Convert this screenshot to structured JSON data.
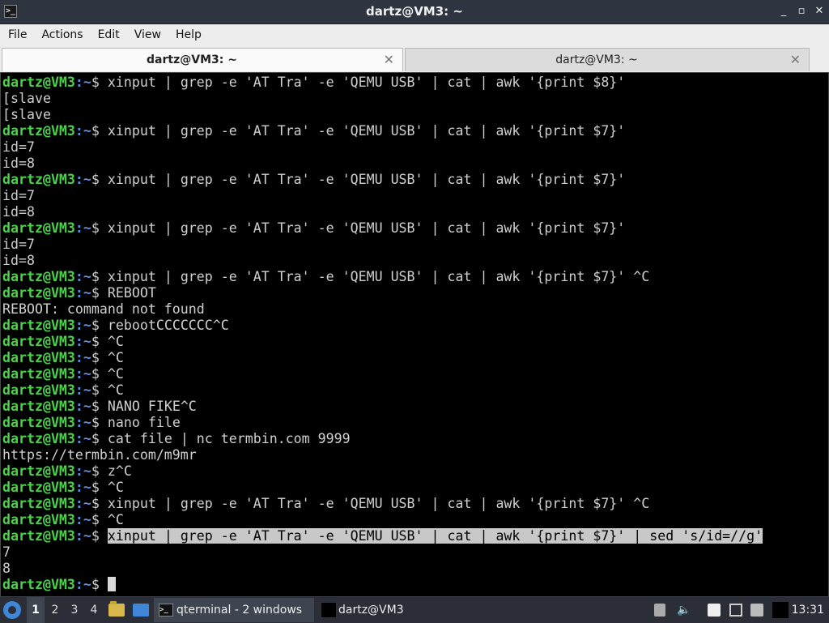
{
  "window": {
    "title": "dartz@VM3: ~",
    "controls": [
      "_",
      "▫",
      "✕"
    ]
  },
  "menu": [
    "File",
    "Actions",
    "Edit",
    "View",
    "Help"
  ],
  "tabs": [
    {
      "label": "dartz@VM3: ~",
      "active": true
    },
    {
      "label": "dartz@VM3: ~",
      "active": false
    }
  ],
  "terminal": {
    "lines": [
      {
        "user": "dartz@VM3",
        "path": "~",
        "cmd": "xinput | grep -e 'AT Tra' -e 'QEMU USB' | cat | awk '{print $8}'"
      },
      {
        "out": "[slave"
      },
      {
        "out": "[slave"
      },
      {
        "user": "dartz@VM3",
        "path": "~",
        "cmd": "xinput | grep -e 'AT Tra' -e 'QEMU USB' | cat | awk '{print $7}'"
      },
      {
        "out": "id=7"
      },
      {
        "out": "id=8"
      },
      {
        "user": "dartz@VM3",
        "path": "~",
        "cmd": "xinput | grep -e 'AT Tra' -e 'QEMU USB' | cat | awk '{print $7}'"
      },
      {
        "out": "id=7"
      },
      {
        "out": "id=8"
      },
      {
        "user": "dartz@VM3",
        "path": "~",
        "cmd": "xinput | grep -e 'AT Tra' -e 'QEMU USB' | cat | awk '{print $7}'"
      },
      {
        "out": "id=7"
      },
      {
        "out": "id=8"
      },
      {
        "user": "dartz@VM3",
        "path": "~",
        "cmd": "xinput | grep -e 'AT Tra' -e 'QEMU USB' | cat | awk '{print $7}' ^C"
      },
      {
        "user": "dartz@VM3",
        "path": "~",
        "cmd": "REBOOT"
      },
      {
        "out": "REBOOT: command not found"
      },
      {
        "user": "dartz@VM3",
        "path": "~",
        "cmd": "rebootCCCCCCC^C"
      },
      {
        "user": "dartz@VM3",
        "path": "~",
        "cmd": "^C"
      },
      {
        "user": "dartz@VM3",
        "path": "~",
        "cmd": "^C"
      },
      {
        "user": "dartz@VM3",
        "path": "~",
        "cmd": "^C"
      },
      {
        "user": "dartz@VM3",
        "path": "~",
        "cmd": "^C"
      },
      {
        "user": "dartz@VM3",
        "path": "~",
        "cmd": "NANO FIKE^C"
      },
      {
        "user": "dartz@VM3",
        "path": "~",
        "cmd": "nano file"
      },
      {
        "user": "dartz@VM3",
        "path": "~",
        "cmd": "cat file | nc termbin.com 9999"
      },
      {
        "out": "https://termbin.com/m9mr"
      },
      {
        "user": "dartz@VM3",
        "path": "~",
        "cmd": "z^C"
      },
      {
        "user": "dartz@VM3",
        "path": "~",
        "cmd": "^C"
      },
      {
        "user": "dartz@VM3",
        "path": "~",
        "cmd": "xinput | grep -e 'AT Tra' -e 'QEMU USB' | cat | awk '{print $7}' ^C"
      },
      {
        "user": "dartz@VM3",
        "path": "~",
        "cmd": "^C"
      },
      {
        "user": "dartz@VM3",
        "path": "~",
        "cmd": "xinput | grep -e 'AT Tra' -e 'QEMU USB' | cat | awk '{print $7}' | sed 's/id=//g'",
        "selected": true
      },
      {
        "out": "7"
      },
      {
        "out": "8"
      },
      {
        "user": "dartz@VM3",
        "path": "~",
        "cmd": "",
        "cursor": true
      }
    ]
  },
  "taskbar": {
    "workspaces": [
      "1",
      "2",
      "3",
      "4"
    ],
    "active_workspace": "1",
    "tasks": [
      {
        "label": "qterminal - 2 windows",
        "icon": ">_"
      },
      {
        "label": "dartz@VM3",
        "icon": ""
      }
    ],
    "clock": "13:31"
  },
  "colors": {
    "prompt_user": "#4ad34a",
    "prompt_path": "#5b8fe0",
    "selection": "#c8c8c8",
    "titlebar": "#2e3440",
    "taskbar": "#2b2e37"
  }
}
